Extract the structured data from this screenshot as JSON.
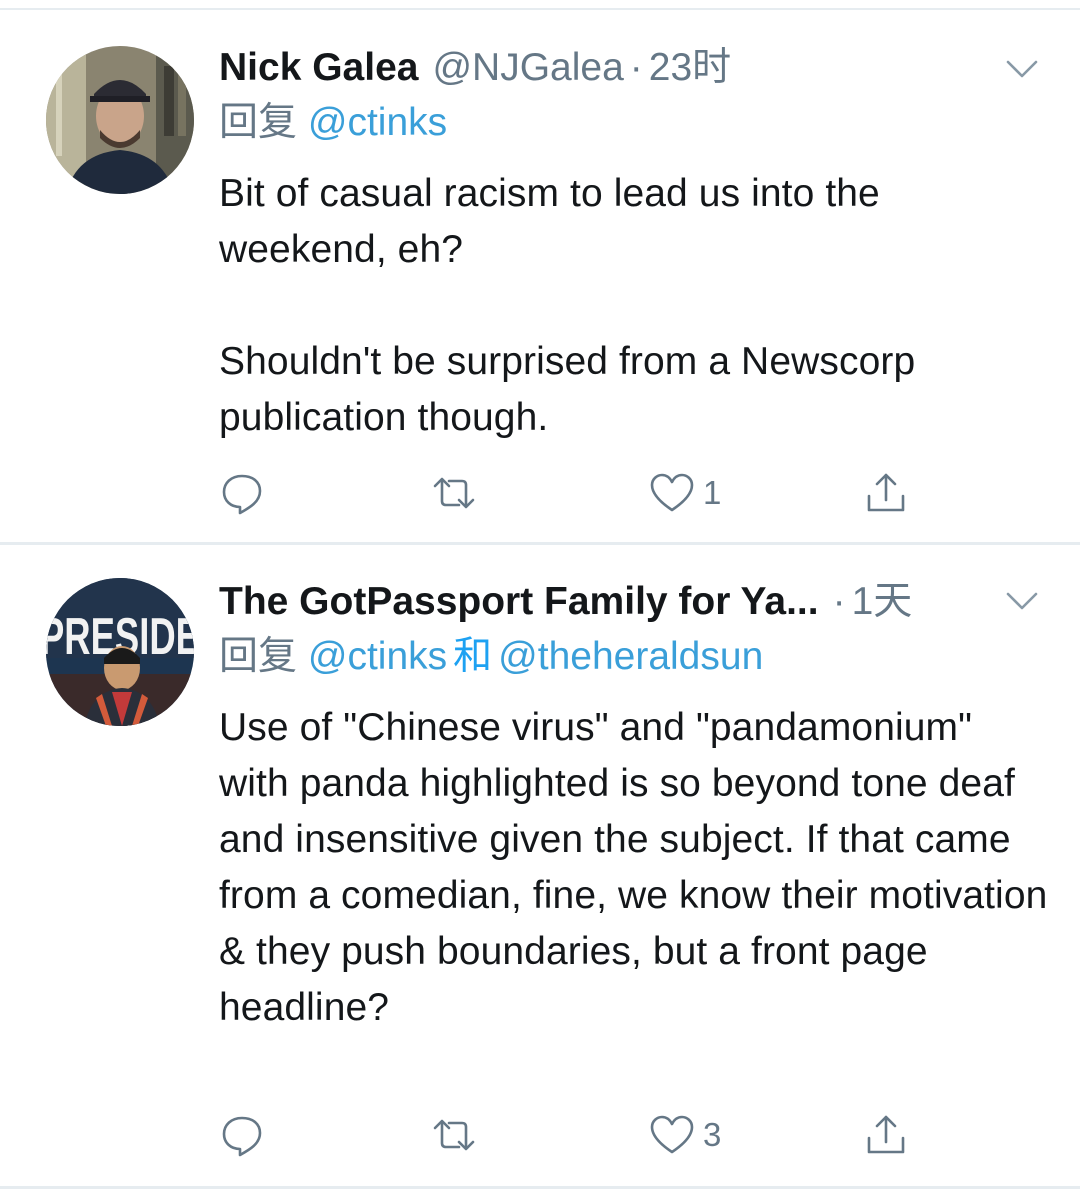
{
  "tweets": [
    {
      "author_name": "Nick Galea",
      "author_handle": "@NJGalea",
      "separator": "·",
      "time": "23时",
      "reply_prefix": "回复",
      "reply_to": [
        "@ctinks"
      ],
      "reply_join": "",
      "body": "Bit of casual racism to lead us into the weekend, eh?\n\nShouldn't be surprised from a Newscorp publication though.",
      "reply_count": "",
      "retweet_count": "",
      "like_count": "1",
      "avatar": "profile-photo-man-in-cap",
      "menu_icon": "chevron-down-icon"
    },
    {
      "author_name": "The GotPassport Family for Ya...",
      "author_handle": "",
      "separator": "·",
      "time": "1天",
      "reply_prefix": "回复",
      "reply_to": [
        "@ctinks",
        "@theheraldsun"
      ],
      "reply_join": "和",
      "body": "Use of \"Chinese virus\" and \"pandamonium\" with panda highlighted is so beyond tone deaf and insensitive given the subject. If that came from a comedian, fine, we know their motivation & they push boundaries, but a front page headline?",
      "reply_count": "",
      "retweet_count": "",
      "like_count": "3",
      "avatar": "profile-photo-man-before-bus-banner",
      "avatar_banner_text": "PRESIDE",
      "menu_icon": "chevron-down-icon"
    }
  ],
  "icons": {
    "reply": "reply-bubble-icon",
    "retweet": "retweet-icon",
    "like": "heart-icon",
    "share": "share-icon"
  },
  "colors": {
    "text": "#14171a",
    "secondary": "#657786",
    "link": "#1da1f2",
    "divider": "#e6ecf0"
  }
}
